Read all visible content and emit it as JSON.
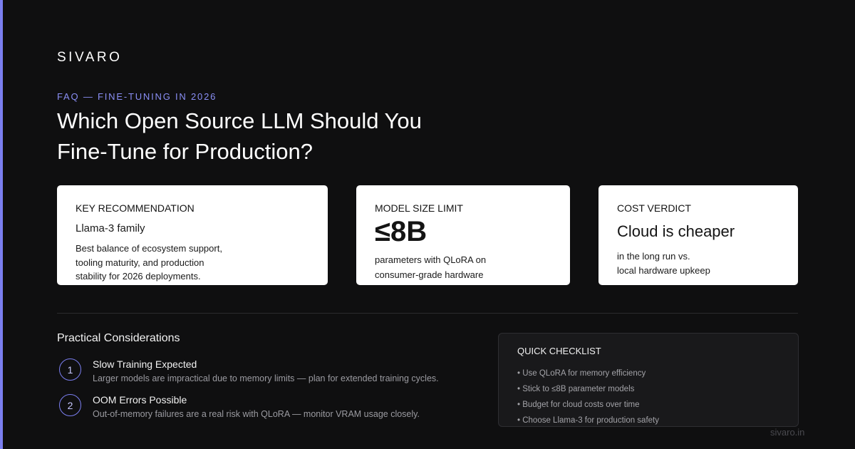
{
  "brand": "SIVARO",
  "eyebrow": "FAQ — FINE-TUNING IN 2026",
  "title_lines": [
    "Which Open Source LLM Should You",
    "Fine-Tune for Production?"
  ],
  "cards": {
    "recommendation": {
      "label": "KEY RECOMMENDATION",
      "sub": "Llama-3 family",
      "desc_lines": [
        "Best balance of ecosystem support,",
        "tooling maturity, and production",
        "stability for 2026 deployments."
      ]
    },
    "size": {
      "label": "MODEL SIZE LIMIT",
      "big": "≤8B",
      "desc_lines": [
        "parameters with QLoRA on",
        "consumer-grade hardware"
      ]
    },
    "cost": {
      "label": "COST VERDICT",
      "verdict": "Cloud is cheaper",
      "desc_lines": [
        "in the long run vs.",
        "local hardware upkeep"
      ]
    }
  },
  "practical": {
    "title": "Practical Considerations",
    "items": [
      {
        "num": "1",
        "title": "Slow Training Expected",
        "desc": "Larger models are impractical due to memory limits — plan for extended training cycles."
      },
      {
        "num": "2",
        "title": "OOM Errors Possible",
        "desc": "Out-of-memory failures are a real risk with QLoRA — monitor VRAM usage closely."
      }
    ]
  },
  "checklist": {
    "title": "QUICK CHECKLIST",
    "items": [
      "• Use QLoRA for memory efficiency",
      "• Stick to ≤8B parameter models",
      "• Budget for cloud costs over time",
      "• Choose Llama-3 for production safety"
    ]
  },
  "footer_url": "sivaro.in",
  "colors": {
    "accent": "#7b7ff0",
    "background": "#0f0f10",
    "card": "#ffffff"
  }
}
